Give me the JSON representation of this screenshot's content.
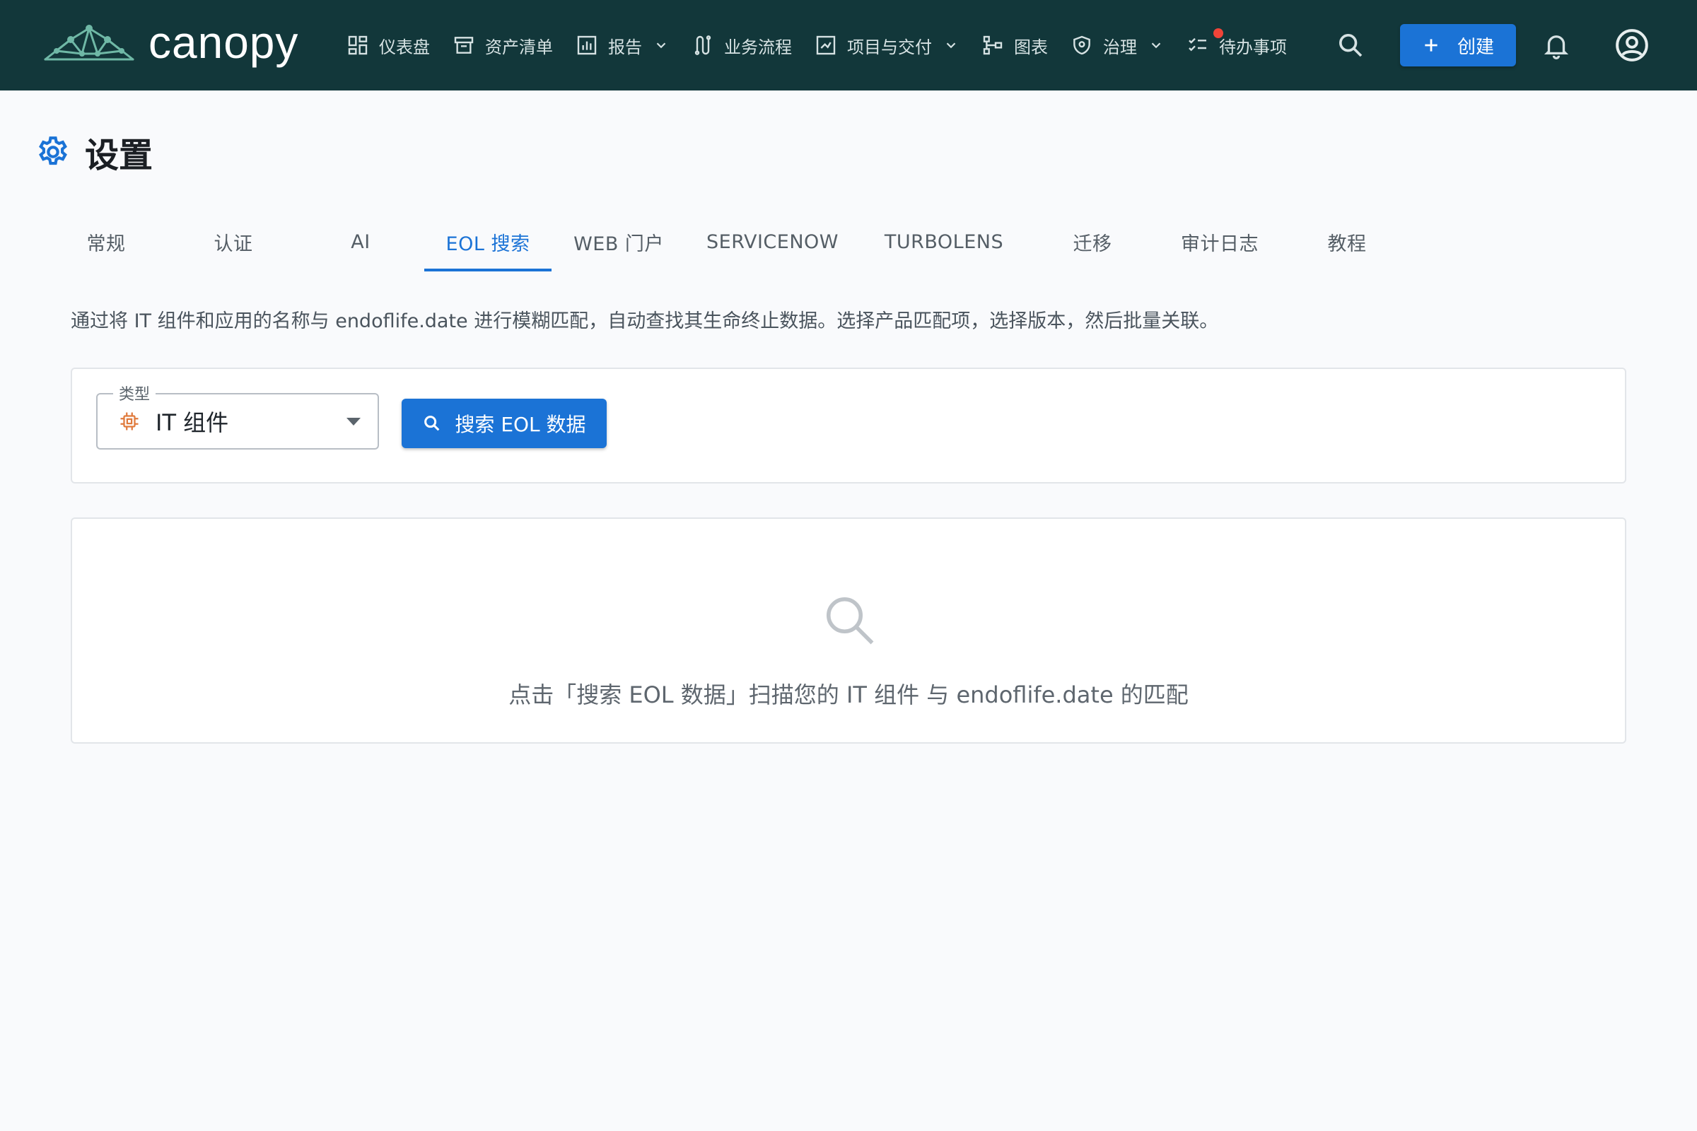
{
  "app": {
    "brand": "canopy",
    "colors": {
      "nav_bg": "#12373a",
      "accent": "#1b73d6",
      "notify_dot": "#f04438"
    }
  },
  "nav": {
    "items": [
      {
        "label": "仪表盘",
        "icon": "dashboard-icon",
        "has_menu": false
      },
      {
        "label": "资产清单",
        "icon": "archive-icon",
        "has_menu": false
      },
      {
        "label": "报告",
        "icon": "bar-chart-icon",
        "has_menu": true
      },
      {
        "label": "业务流程",
        "icon": "process-icon",
        "has_menu": false
      },
      {
        "label": "项目与交付",
        "icon": "project-icon",
        "has_menu": true
      },
      {
        "label": "图表",
        "icon": "diagram-icon",
        "has_menu": false
      },
      {
        "label": "治理",
        "icon": "shield-icon",
        "has_menu": true
      },
      {
        "label": "待办事项",
        "icon": "checklist-icon",
        "has_menu": false,
        "has_notification": true
      }
    ],
    "create_label": "创建"
  },
  "page": {
    "title": "设置",
    "icon": "gear-icon"
  },
  "tabs": [
    {
      "label": "常规",
      "active": false
    },
    {
      "label": "认证",
      "active": false
    },
    {
      "label": "AI",
      "active": false
    },
    {
      "label": "EOL 搜索",
      "active": true
    },
    {
      "label": "WEB 门户",
      "active": false
    },
    {
      "label": "SERVICENOW",
      "active": false
    },
    {
      "label": "TURBOLENS",
      "active": false
    },
    {
      "label": "迁移",
      "active": false
    },
    {
      "label": "审计日志",
      "active": false
    },
    {
      "label": "教程",
      "active": false
    }
  ],
  "eol": {
    "description": "通过将 IT 组件和应用的名称与 endoflife.date 进行模糊匹配，自动查找其生命终止数据。选择产品匹配项，选择版本，然后批量关联。",
    "type_label": "类型",
    "type_value": "IT 组件",
    "search_button": "搜索 EOL 数据",
    "empty_text": "点击「搜索 EOL 数据」扫描您的 IT 组件 与 endoflife.date 的匹配"
  }
}
